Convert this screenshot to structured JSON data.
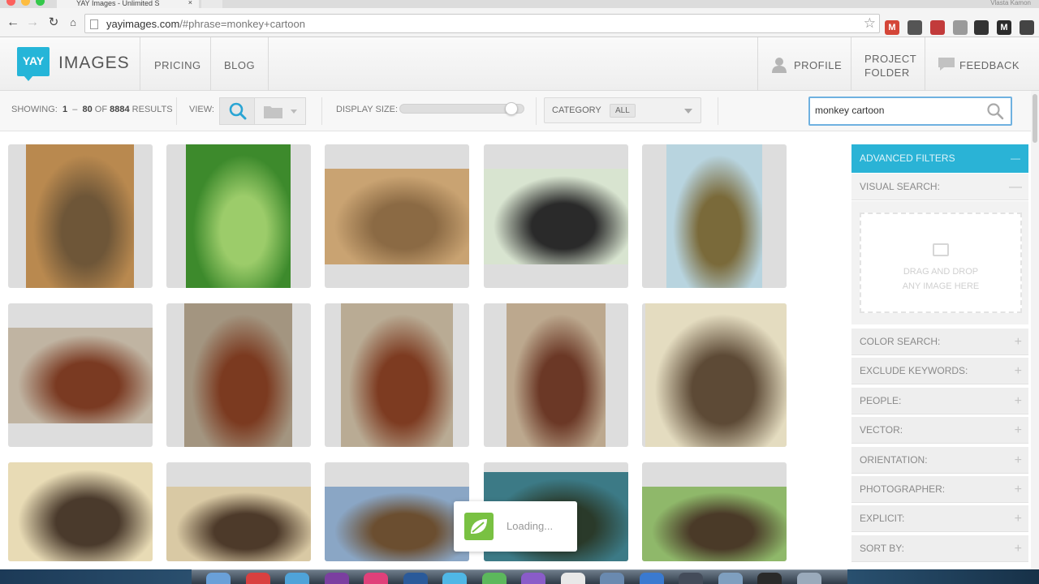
{
  "browser": {
    "tab_title": "YAY Images - Unlimited S",
    "tab_close": "×",
    "profile_name": "Vlasta Kamon",
    "url_host": "yayimages.com",
    "url_path": "/#phrase=monkey+cartoon",
    "extensions": [
      {
        "name": "gmail-extension",
        "label": "M",
        "color": "#d44638"
      },
      {
        "name": "pocket-extension",
        "label": "",
        "color": "#555555"
      },
      {
        "name": "incognito-extension",
        "label": "",
        "color": "#c23b3b"
      },
      {
        "name": "download-extension",
        "label": "",
        "color": "#9a9a9a"
      },
      {
        "name": "settings-extension",
        "label": "",
        "color": "#333333"
      },
      {
        "name": "m-extension",
        "label": "M",
        "color": "#2b2b2b"
      },
      {
        "name": "menu-extension",
        "label": "",
        "color": "#444444"
      }
    ]
  },
  "header": {
    "logo_badge": "YAY",
    "logo_text": "IMAGES",
    "nav": [
      "PRICING",
      "BLOG"
    ],
    "profile": "PROFILE",
    "project_folder_line1": "PROJECT",
    "project_folder_line2": "FOLDER",
    "feedback": "FEEDBACK"
  },
  "filter_bar": {
    "showing_label": "SHOWING:",
    "range_start": "1",
    "range_dash": "–",
    "range_end": "80",
    "of_label": "OF",
    "total": "8884",
    "results_label": "RESULTS",
    "view_label": "VIEW:",
    "display_size_label": "DISPLAY SIZE:",
    "display_size_level": 0.95,
    "category_label": "CATEGORY",
    "category_value": "ALL",
    "search_value": "monkey cartoon"
  },
  "grid": {
    "tiles": [
      {
        "colors": [
          "#b9894f",
          "#6e5638"
        ]
      },
      {
        "colors": [
          "#3d8a2c",
          "#9ccc6a"
        ]
      },
      {
        "colors": [
          "#c9a372",
          "#8b6a44"
        ]
      },
      {
        "colors": [
          "#d8e4d0",
          "#2a2a2a"
        ]
      },
      {
        "colors": [
          "#b8d4df",
          "#7a6a3a"
        ]
      },
      {
        "colors": [
          "#c0b4a2",
          "#7a3a22"
        ]
      },
      {
        "colors": [
          "#a39580",
          "#7b3a20"
        ]
      },
      {
        "colors": [
          "#b9ab94",
          "#7d3b21"
        ]
      },
      {
        "colors": [
          "#bca88e",
          "#6b3826"
        ]
      },
      {
        "colors": [
          "#e4dcc0",
          "#5d4a36"
        ]
      },
      {
        "colors": [
          "#e8dbb5",
          "#4a3a2c"
        ]
      },
      {
        "colors": [
          "#d9c9a4",
          "#4d3a2a"
        ]
      },
      {
        "colors": [
          "#8aa6c5",
          "#6b4e30"
        ]
      },
      {
        "colors": [
          "#3c7a86",
          "#2a3a2a"
        ]
      },
      {
        "colors": [
          "#8fb86a",
          "#4a3a28"
        ]
      }
    ]
  },
  "sidebar": {
    "advanced_filters": "ADVANCED FILTERS",
    "visual_search": "VISUAL SEARCH:",
    "dropzone_line1": "DRAG AND DROP",
    "dropzone_line2": "ANY IMAGE HERE",
    "rows": [
      "COLOR SEARCH:",
      "EXCLUDE KEYWORDS:",
      "PEOPLE:",
      "VECTOR:",
      "ORIENTATION:",
      "PHOTOGRAPHER:",
      "EXPLICIT:",
      "SORT BY:"
    ],
    "expand_symbol": "+",
    "collapse_symbol": "—"
  },
  "loading": {
    "text": "Loading..."
  },
  "dock": {
    "colors": [
      "#6aa0d8",
      "#d94040",
      "#4fa3d9",
      "#7b3fa0",
      "#e0407a",
      "#2a5a9a",
      "#4fb7e6",
      "#5cb85c",
      "#8a5cc8",
      "#e8e8e8",
      "#6a8ab0",
      "#3a7ad0",
      "#444c5a",
      "#7f9fbf",
      "#2a2a2a",
      "#9aaabb"
    ]
  }
}
